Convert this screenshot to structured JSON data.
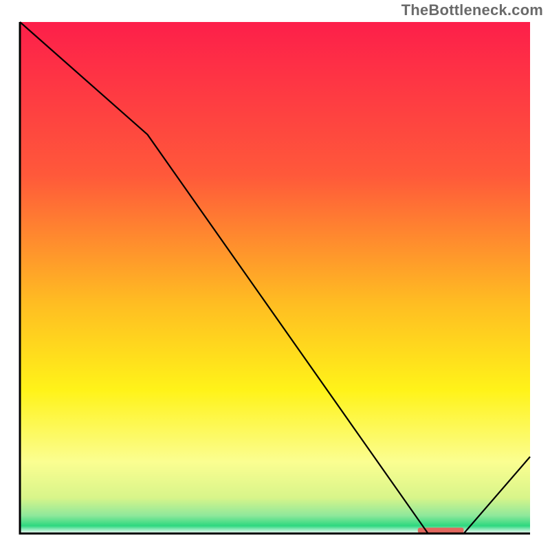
{
  "attribution": "TheBottleneck.com",
  "chart_data": {
    "type": "line",
    "title": "",
    "xlabel": "",
    "ylabel": "",
    "xlim": [
      0,
      100
    ],
    "ylim": [
      0,
      100
    ],
    "grid": false,
    "x": [
      0,
      25,
      80,
      87,
      100
    ],
    "values": [
      100,
      78,
      0,
      0,
      15
    ],
    "annotation": {
      "x_start": 78,
      "x_end": 87,
      "y": 0.6,
      "color": "#e2675e",
      "label": ""
    },
    "background": {
      "type": "vertical-gradient",
      "stops": [
        {
          "pos": 0.0,
          "color": "#fd1f4a"
        },
        {
          "pos": 0.3,
          "color": "#ff593a"
        },
        {
          "pos": 0.55,
          "color": "#ffbd22"
        },
        {
          "pos": 0.72,
          "color": "#fff319"
        },
        {
          "pos": 0.86,
          "color": "#fbfe91"
        },
        {
          "pos": 0.93,
          "color": "#d8f58a"
        },
        {
          "pos": 0.965,
          "color": "#8ee89b"
        },
        {
          "pos": 0.985,
          "color": "#2dd87f"
        },
        {
          "pos": 1.0,
          "color": "#ffffff"
        }
      ]
    },
    "axis_color": "#000000",
    "line_color": "#000000",
    "line_width": 2.2
  }
}
